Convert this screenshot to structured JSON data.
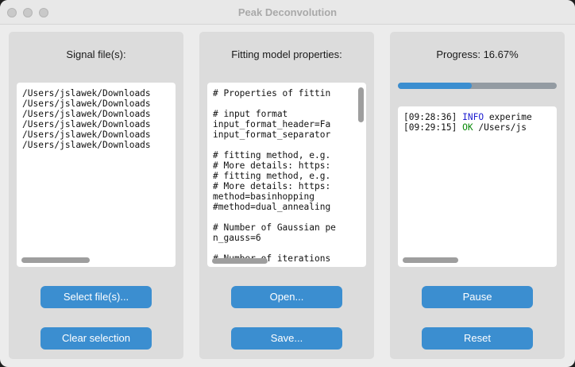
{
  "window": {
    "title": "Peak Deconvolution"
  },
  "signal_panel": {
    "title": "Signal file(s):",
    "files": [
      "/Users/jslawek/Downloads",
      "/Users/jslawek/Downloads",
      "/Users/jslawek/Downloads",
      "/Users/jslawek/Downloads",
      "/Users/jslawek/Downloads",
      "/Users/jslawek/Downloads"
    ],
    "select_button": "Select file(s)...",
    "clear_button": "Clear selection"
  },
  "model_panel": {
    "title": "Fitting model properties:",
    "lines": [
      "# Properties of fittin",
      "",
      "# input format",
      "input_format_header=Fa",
      "input_format_separator",
      "",
      "# fitting method, e.g.",
      "# More details: https:",
      "# fitting method, e.g.",
      "# More details: https:",
      "method=basinhopping",
      "#method=dual_annealing",
      "",
      "# Number of Gaussian pe",
      "n_gauss=6",
      "",
      "# Number of iterations"
    ],
    "open_button": "Open...",
    "save_button": "Save..."
  },
  "progress_panel": {
    "title": "Progress: 16.67%",
    "progress_fraction": 0.4636,
    "log": [
      {
        "time": "[09:28:36]",
        "level": "INFO",
        "message": "experime",
        "level_color": "#1d1dd0"
      },
      {
        "time": "[09:29:15]",
        "level": "OK",
        "message": "/Users/js",
        "level_color": "#0a8a0a"
      }
    ],
    "pause_button": "Pause",
    "reset_button": "Reset"
  },
  "colors": {
    "accent": "#3b8ed0",
    "track": "#939ba2",
    "panel": "#dcdcdc"
  }
}
